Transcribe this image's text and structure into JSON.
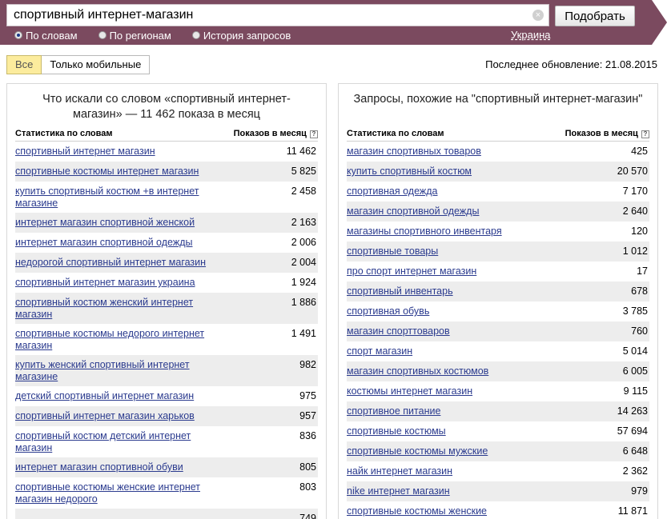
{
  "search": {
    "query": "спортивный интернет-магазин",
    "submit_label": "Подобрать",
    "clear_symbol": "×"
  },
  "modes": [
    {
      "label": "По словам",
      "selected": true
    },
    {
      "label": "По регионам",
      "selected": false
    },
    {
      "label": "История запросов",
      "selected": false
    }
  ],
  "region": "Украина",
  "filters": {
    "all": "Все",
    "mobile": "Только мобильные"
  },
  "last_update": "Последнее обновление: 21.08.2015",
  "left_panel": {
    "title": "Что искали со словом «спортивный интернет-магазин» — 11 462 показа в месяц",
    "col_query": "Статистика по словам",
    "col_count": "Показов в месяц",
    "rows": [
      {
        "q": "спортивный интернет магазин",
        "v": "11 462"
      },
      {
        "q": "спортивные костюмы интернет магазин",
        "v": "5 825"
      },
      {
        "q": "купить спортивный костюм +в интернет магазине",
        "v": "2 458"
      },
      {
        "q": "интернет магазин спортивной женской",
        "v": "2 163"
      },
      {
        "q": "интернет магазин спортивной одежды",
        "v": "2 006"
      },
      {
        "q": "недорогой спортивный интернет магазин",
        "v": "2 004"
      },
      {
        "q": "спортивный интернет магазин украина",
        "v": "1 924"
      },
      {
        "q": "спортивный костюм женский интернет магазин",
        "v": "1 886"
      },
      {
        "q": "спортивные костюмы недорого интернет магазин",
        "v": "1 491"
      },
      {
        "q": "купить женский спортивный интернет магазине",
        "v": "982"
      },
      {
        "q": "детский спортивный интернет магазин",
        "v": "975"
      },
      {
        "q": "спортивный интернет магазин харьков",
        "v": "957"
      },
      {
        "q": "спортивный костюм детский интернет магазин",
        "v": "836"
      },
      {
        "q": "интернет магазин спортивной обуви",
        "v": "805"
      },
      {
        "q": "спортивные костюмы женские интернет магазин недорого",
        "v": "803"
      },
      {
        "q": "",
        "v": "749"
      }
    ]
  },
  "right_panel": {
    "title": "Запросы, похожие на \"спортивный интернет-магазин\"",
    "col_query": "Статистика по словам",
    "col_count": "Показов в месяц",
    "rows": [
      {
        "q": "магазин спортивных товаров",
        "v": "425"
      },
      {
        "q": "купить спортивный костюм",
        "v": "20 570"
      },
      {
        "q": "спортивная одежда",
        "v": "7 170"
      },
      {
        "q": "магазин спортивной одежды",
        "v": "2 640"
      },
      {
        "q": "магазины спортивного инвентаря",
        "v": "120"
      },
      {
        "q": "спортивные товары",
        "v": "1 012"
      },
      {
        "q": "про спорт интернет магазин",
        "v": "17"
      },
      {
        "q": "спортивный инвентарь",
        "v": "678"
      },
      {
        "q": "спортивная обувь",
        "v": "3 785"
      },
      {
        "q": "магазин спорттоваров",
        "v": "760"
      },
      {
        "q": "спорт магазин",
        "v": "5 014"
      },
      {
        "q": "магазин спортивных костюмов",
        "v": "6 005"
      },
      {
        "q": "костюмы интернет магазин",
        "v": "9 115"
      },
      {
        "q": "спортивное питание",
        "v": "14 263"
      },
      {
        "q": "спортивные костюмы",
        "v": "57 694"
      },
      {
        "q": "спортивные костюмы мужские",
        "v": "6 648"
      },
      {
        "q": "найк интернет магазин",
        "v": "2 362"
      },
      {
        "q": "nike интернет магазин",
        "v": "979"
      },
      {
        "q": "спортивные костюмы женские",
        "v": "11 871"
      }
    ]
  },
  "colors": {
    "header": "#7b4a5f",
    "link": "#2a3a8e",
    "active_filter": "#fcec9d",
    "row_alt": "#ededed"
  }
}
